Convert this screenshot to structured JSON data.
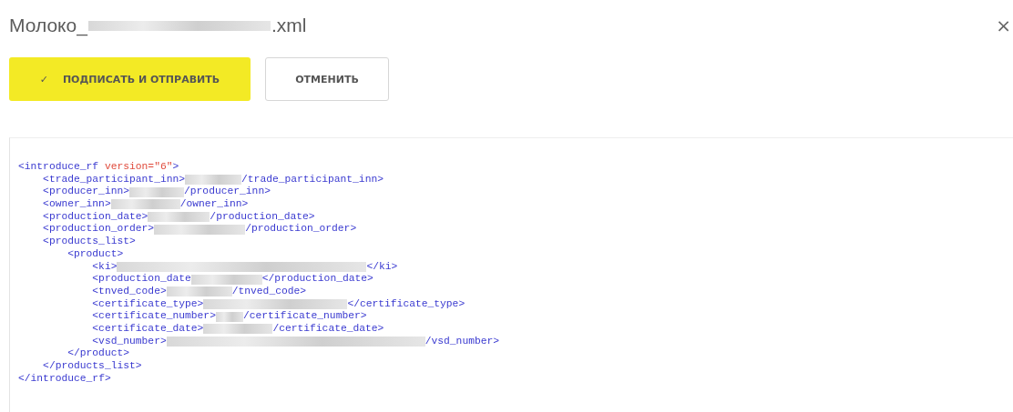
{
  "dialog": {
    "title_prefix": "Молоко_",
    "title_redacted": true,
    "title_suffix": ".xml",
    "close": "×"
  },
  "buttons": [
    {
      "kind": "primary",
      "icon": "✓",
      "label": "ПОДПИСАТЬ И ОТПРАВИТЬ"
    },
    {
      "kind": "secondary",
      "label": "ОТМЕНИТЬ"
    }
  ],
  "xml": {
    "open": "<introduce_rf",
    "attribute": "version=\"6\"",
    "open_end": ">",
    "close": "</introduce_rf>",
    "children": [
      {
        "open": "<trade_participant_inn>",
        "redacted": true,
        "close": "/trade_participant_inn>"
      },
      {
        "open": "<producer_inn>",
        "redacted": true,
        "close": "/producer_inn>"
      },
      {
        "open": "<owner_inn>",
        "redacted": true,
        "close": "/owner_inn>"
      },
      {
        "open": "<production_date>",
        "redacted": true,
        "close": "/production_date>"
      },
      {
        "open": "<production_order>",
        "redacted": true,
        "close": "/production_order>"
      },
      {
        "open": "<products_list>",
        "close": "</products_list>",
        "children": [
          {
            "open": "<product>",
            "close": "</product>",
            "children": [
              {
                "open": "<ki>",
                "redacted": true,
                "close": "</ki>"
              },
              {
                "open": "<production_date",
                "redacted": true,
                "close": "</production_date>"
              },
              {
                "open": "<tnved_code>",
                "redacted": true,
                "close": "/tnved_code>"
              },
              {
                "open": "<certificate_type>",
                "redacted": true,
                "close": "</certificate_type>"
              },
              {
                "open": "<certificate_number>",
                "redacted": true,
                "close": "/certificate_number>"
              },
              {
                "open": "<certificate_date>",
                "redacted": true,
                "close": "/certificate_date>"
              },
              {
                "open": "<vsd_number>",
                "redacted": true,
                "close": "/vsd_number>"
              }
            ]
          }
        ]
      }
    ]
  }
}
